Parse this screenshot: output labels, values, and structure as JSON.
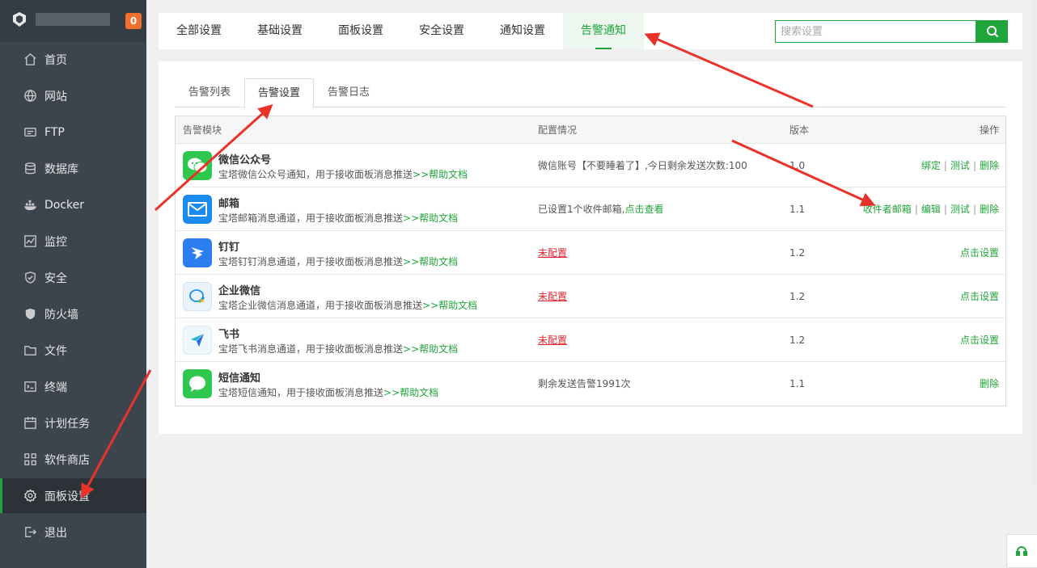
{
  "sidebar": {
    "badge": "0",
    "items": [
      {
        "label": "首页",
        "icon": "home-icon"
      },
      {
        "label": "网站",
        "icon": "globe-icon"
      },
      {
        "label": "FTP",
        "icon": "ftp-icon"
      },
      {
        "label": "数据库",
        "icon": "database-icon"
      },
      {
        "label": "Docker",
        "icon": "docker-icon"
      },
      {
        "label": "监控",
        "icon": "monitor-icon"
      },
      {
        "label": "安全",
        "icon": "shield-icon"
      },
      {
        "label": "防火墙",
        "icon": "firewall-icon"
      },
      {
        "label": "文件",
        "icon": "folder-icon"
      },
      {
        "label": "终端",
        "icon": "terminal-icon"
      },
      {
        "label": "计划任务",
        "icon": "calendar-icon"
      },
      {
        "label": "软件商店",
        "icon": "grid-icon"
      },
      {
        "label": "面板设置",
        "icon": "gear-icon"
      },
      {
        "label": "退出",
        "icon": "logout-icon"
      }
    ]
  },
  "topbar": {
    "tabs": [
      "全部设置",
      "基础设置",
      "面板设置",
      "安全设置",
      "通知设置",
      "告警通知"
    ],
    "search_placeholder": "搜索设置"
  },
  "subtabs": [
    "告警列表",
    "告警设置",
    "告警日志"
  ],
  "table": {
    "headers": {
      "module": "告警模块",
      "config": "配置情况",
      "version": "版本",
      "action": "操作"
    },
    "rows": [
      {
        "name": "微信公众号",
        "desc": "宝塔微信公众号通知，用于接收面板消息推送",
        "help": ">>帮助文档",
        "config": "微信账号【不要睡着了】,今日剩余发送次数:100",
        "config_link": "",
        "version": "1.0",
        "actions": [
          "绑定",
          "测试",
          "删除"
        ]
      },
      {
        "name": "邮箱",
        "desc": "宝塔邮箱消息通道，用于接收面板消息推送",
        "help": ">>帮助文档",
        "config": "已设置1个收件邮箱,",
        "config_link": "点击查看",
        "version": "1.1",
        "actions": [
          "收件者邮箱",
          "编辑",
          "测试",
          "删除"
        ]
      },
      {
        "name": "钉钉",
        "desc": "宝塔钉钉消息通道，用于接收面板消息推送",
        "help": ">>帮助文档",
        "config": "未配置",
        "config_link": "",
        "version": "1.2",
        "actions": [
          "点击设置"
        ]
      },
      {
        "name": "企业微信",
        "desc": "宝塔企业微信消息通道，用于接收面板消息推送",
        "help": ">>帮助文档",
        "config": "未配置",
        "config_link": "",
        "version": "1.2",
        "actions": [
          "点击设置"
        ]
      },
      {
        "name": "飞书",
        "desc": "宝塔飞书消息通道，用于接收面板消息推送",
        "help": ">>帮助文档",
        "config": "未配置",
        "config_link": "",
        "version": "1.2",
        "actions": [
          "点击设置"
        ]
      },
      {
        "name": "短信通知",
        "desc": "宝塔短信通知，用于接收面板消息推送",
        "help": ">>帮助文档",
        "config": "剩余发送告警1991次",
        "config_link": "",
        "version": "1.1",
        "actions": [
          "删除"
        ]
      }
    ]
  },
  "colors": {
    "accent": "#20a53a",
    "sidebar": "#3c444d",
    "warn": "#e0262d",
    "badge": "#f0702c",
    "arrow": "#e8322a"
  }
}
